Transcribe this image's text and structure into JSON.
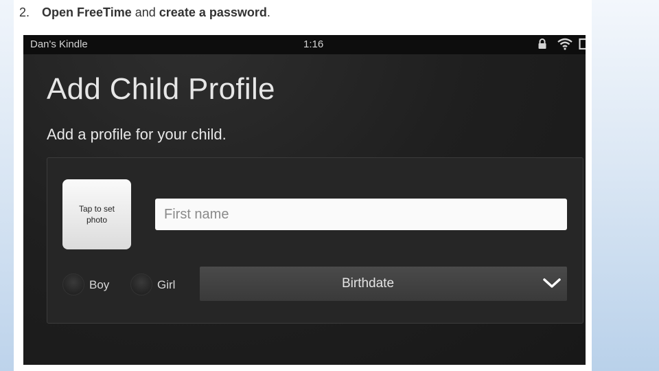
{
  "instruction": {
    "number": "2.",
    "part1": "Open FreeTime",
    "part2": " and ",
    "part3": "create a password",
    "part4": "."
  },
  "statusbar": {
    "device_name": "Dan's Kindle",
    "time": "1:16",
    "icons": [
      "lock-icon",
      "wifi-icon",
      "battery-icon"
    ]
  },
  "screen": {
    "title": "Add Child Profile",
    "subtitle": "Add a profile for your child.",
    "photo_button": "Tap to set photo",
    "first_name_placeholder": "First name",
    "gender_options": [
      "Boy",
      "Girl"
    ],
    "birthdate_label": "Birthdate"
  },
  "colors": {
    "screen_bg": "#1f1f1f",
    "statusbar_bg": "#0d0d0d",
    "card_bg": "#262626",
    "birthdate_bg": "#404040"
  }
}
